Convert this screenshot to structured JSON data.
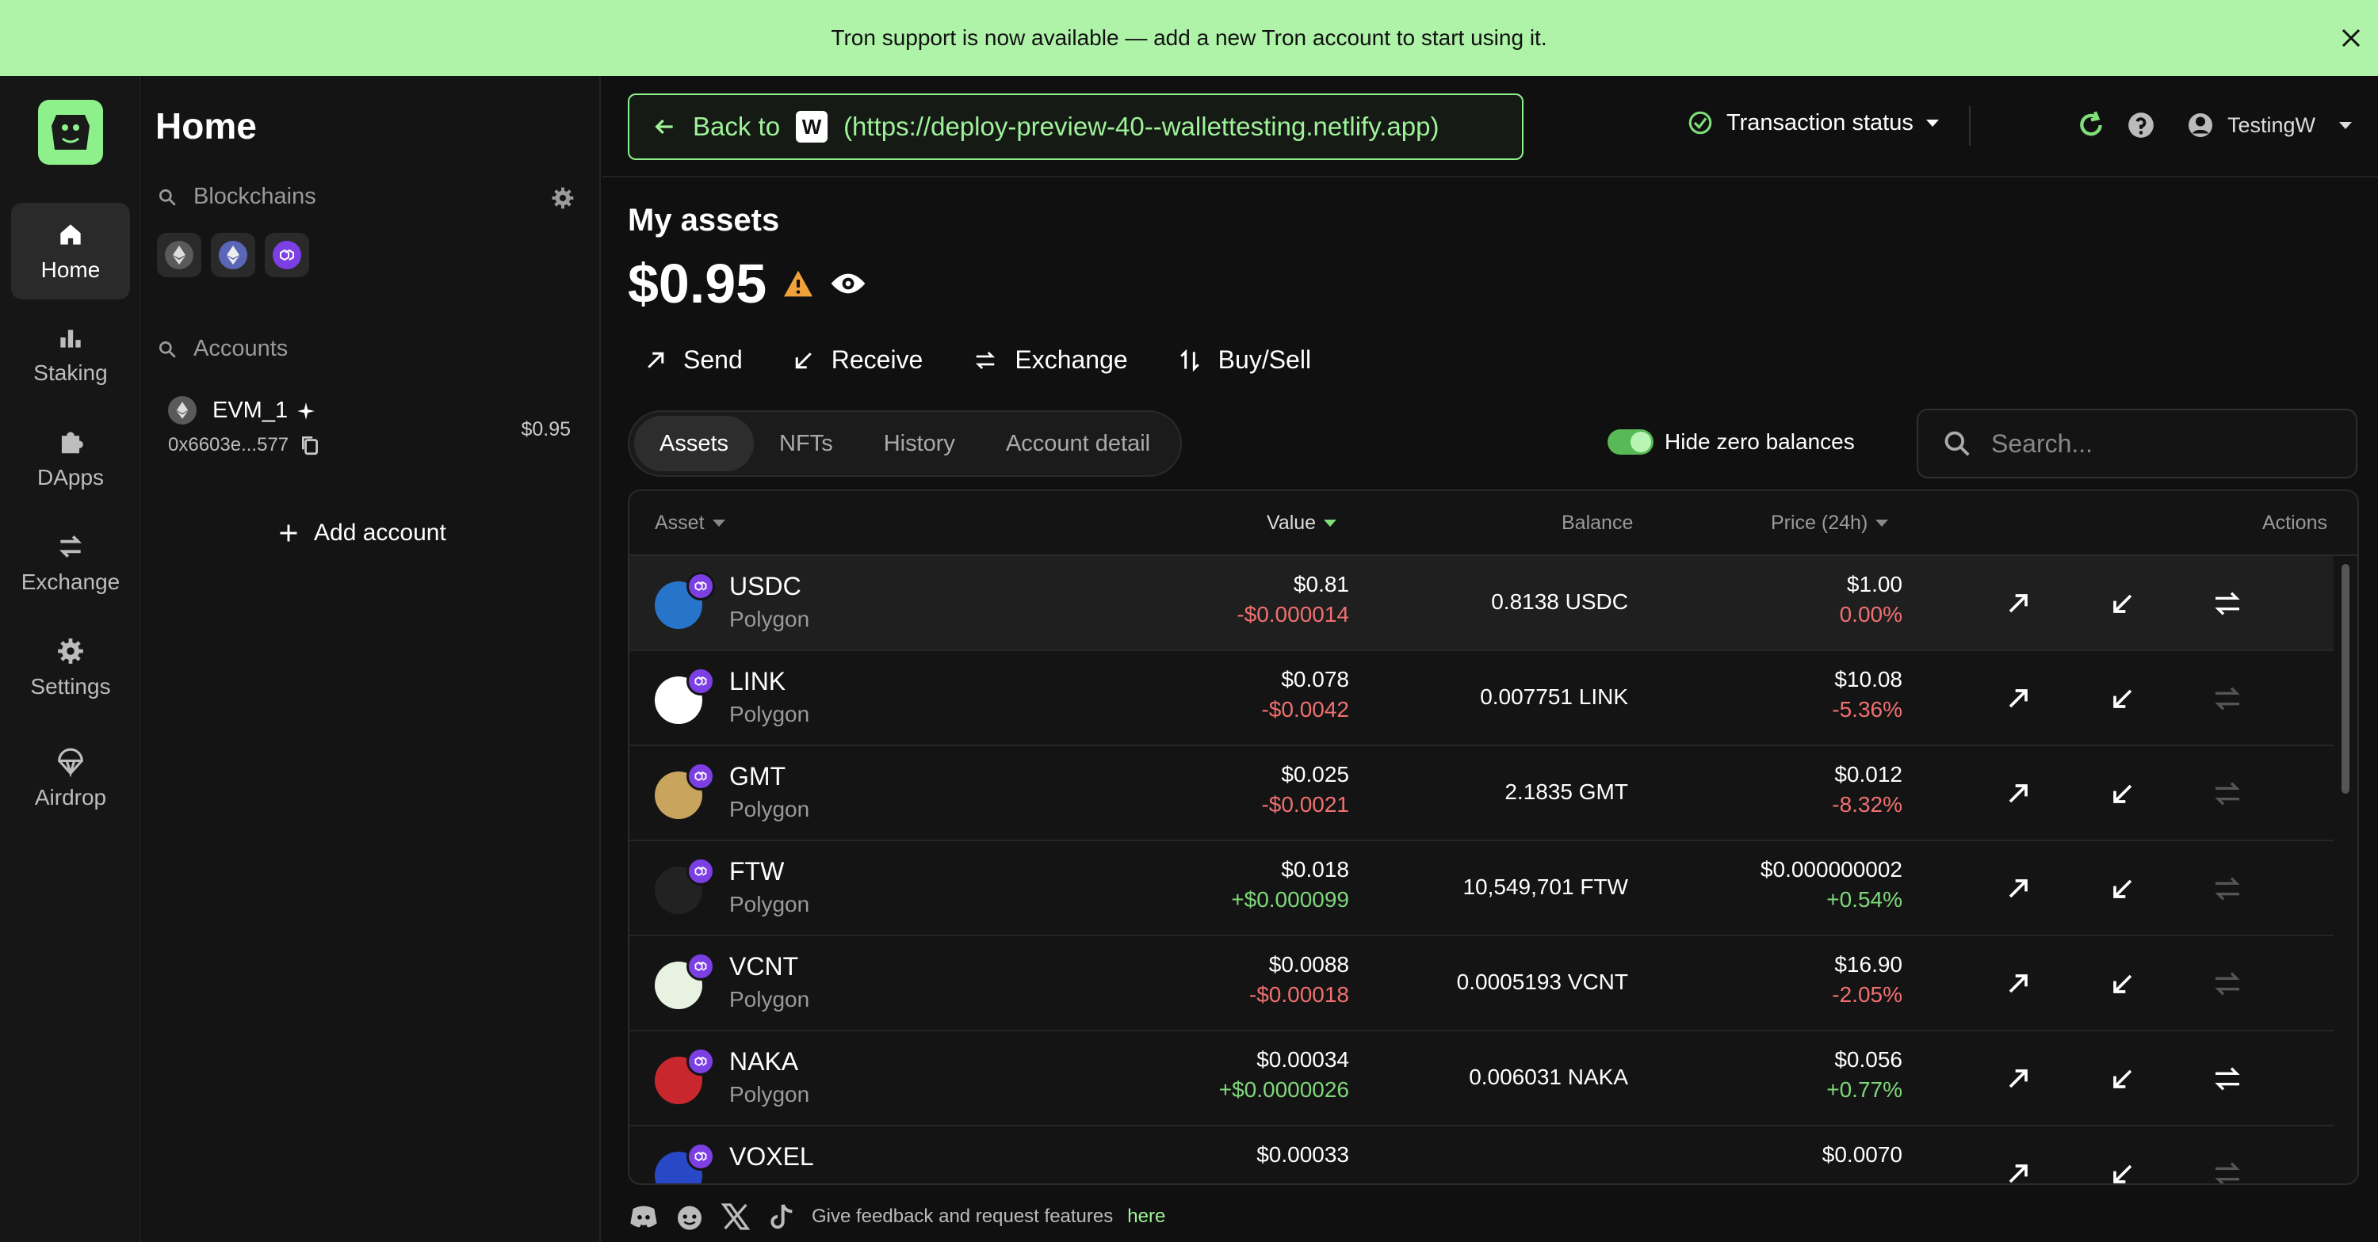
{
  "banner": {
    "text": "Tron support is now available — add a new Tron account to start using it."
  },
  "rail": {
    "items": [
      {
        "label": "Home",
        "icon": "home-icon"
      },
      {
        "label": "Staking",
        "icon": "bar-chart-icon"
      },
      {
        "label": "DApps",
        "icon": "puzzle-icon"
      },
      {
        "label": "Exchange",
        "icon": "swap-icon"
      },
      {
        "label": "Settings",
        "icon": "gear-icon"
      },
      {
        "label": "Airdrop",
        "icon": "parachute-icon"
      }
    ]
  },
  "sidebar": {
    "title": "Home",
    "blockchains_label": "Blockchains",
    "accounts_label": "Accounts",
    "account": {
      "name": "EVM_1",
      "address": "0x6603e...577",
      "value": "$0.95"
    },
    "add_account": "Add account"
  },
  "topbar": {
    "back_prefix": "Back to",
    "back_url": "(https://deploy-preview-40--wallettesting.netlify.app)",
    "back_icon_letter": "W",
    "tx_status": "Transaction status",
    "user": "TestingW"
  },
  "main": {
    "heading": "My assets",
    "total": "$0.95",
    "actions": [
      "Send",
      "Receive",
      "Exchange",
      "Buy/Sell"
    ],
    "tabs": [
      "Assets",
      "NFTs",
      "History",
      "Account detail"
    ],
    "hide_zero": "Hide zero balances",
    "search_placeholder": "Search..."
  },
  "table": {
    "headers": {
      "asset": "Asset",
      "value": "Value",
      "balance": "Balance",
      "price": "Price (24h)",
      "actions": "Actions"
    },
    "rows": [
      {
        "symbol": "USDC",
        "network": "Polygon",
        "value": "$0.81",
        "value_change": "-$0.000014",
        "balance": "0.8138 USDC",
        "price": "$1.00",
        "price_change": "0.00%",
        "swap_enabled": true,
        "icon_color": "#2775ca"
      },
      {
        "symbol": "LINK",
        "network": "Polygon",
        "value": "$0.078",
        "value_change": "-$0.0042",
        "balance": "0.007751 LINK",
        "price": "$10.08",
        "price_change": "-5.36%",
        "swap_enabled": false,
        "icon_color": "#ffffff"
      },
      {
        "symbol": "GMT",
        "network": "Polygon",
        "value": "$0.025",
        "value_change": "-$0.0021",
        "balance": "2.1835 GMT",
        "price": "$0.012",
        "price_change": "-8.32%",
        "swap_enabled": false,
        "icon_color": "#c8a45d"
      },
      {
        "symbol": "FTW",
        "network": "Polygon",
        "value": "$0.018",
        "value_change": "+$0.000099",
        "balance": "10,549,701 FTW",
        "price": "$0.000000002",
        "price_change": "+0.54%",
        "swap_enabled": false,
        "icon_color": "#222222"
      },
      {
        "symbol": "VCNT",
        "network": "Polygon",
        "value": "$0.0088",
        "value_change": "-$0.00018",
        "balance": "0.0005193 VCNT",
        "price": "$16.90",
        "price_change": "-2.05%",
        "swap_enabled": false,
        "icon_color": "#e8f2e0"
      },
      {
        "symbol": "NAKA",
        "network": "Polygon",
        "value": "$0.00034",
        "value_change": "+$0.0000026",
        "balance": "0.006031 NAKA",
        "price": "$0.056",
        "price_change": "+0.77%",
        "swap_enabled": true,
        "icon_color": "#c8282d"
      },
      {
        "symbol": "VOXEL",
        "network": "",
        "value": "$0.00033",
        "value_change": "",
        "balance": "",
        "price": "$0.0070",
        "price_change": "",
        "swap_enabled": false,
        "icon_color": "#2848c8"
      }
    ]
  },
  "footer": {
    "text": "Give feedback and request features",
    "link": "here"
  },
  "colors": {
    "accent": "#8ef08a",
    "banner": "#aef3a8",
    "negative": "#f07070",
    "positive": "#7fd87a",
    "polygon": "#7b3fe4"
  }
}
